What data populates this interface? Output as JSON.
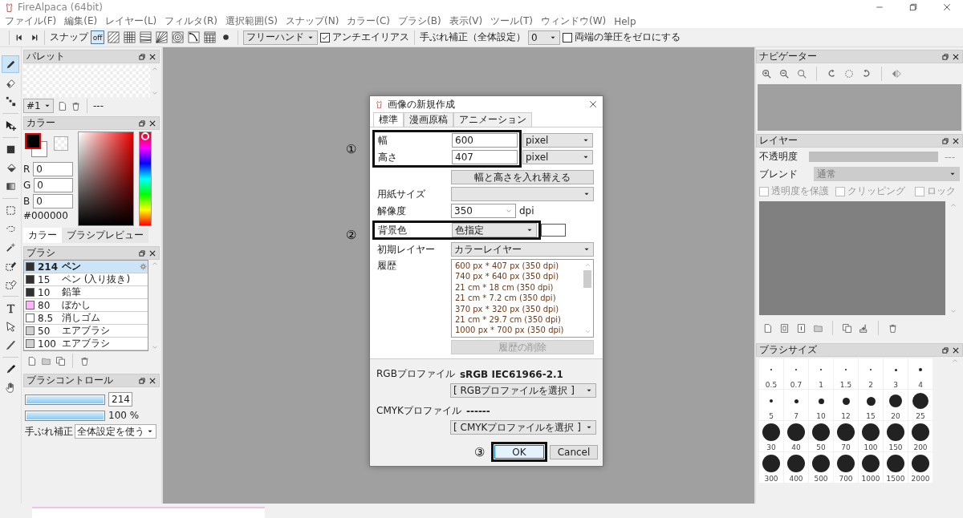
{
  "window": {
    "title": "FireAlpaca (64bit)"
  },
  "menu": [
    "ファイル(F)",
    "編集(E)",
    "レイヤー(L)",
    "フィルタ(R)",
    "選択範囲(S)",
    "スナップ(N)",
    "カラー(C)",
    "ブラシ(B)",
    "表示(V)",
    "ツール(T)",
    "ウィンドウ(W)",
    "Help"
  ],
  "toolbar": {
    "snap_label": "スナップ",
    "snap_modes": [
      {
        "kind": "off",
        "label": "off",
        "selected": true
      },
      {
        "kind": "parallel",
        "selected": false
      },
      {
        "kind": "grid",
        "selected": false
      },
      {
        "kind": "cross",
        "selected": false
      },
      {
        "kind": "radial",
        "selected": false
      },
      {
        "kind": "concentric",
        "selected": false
      },
      {
        "kind": "curve",
        "selected": false
      },
      {
        "kind": "perspective",
        "selected": false
      },
      {
        "kind": "point",
        "selected": false
      }
    ],
    "stroke_mode": "フリーハンド",
    "antialias": {
      "label": "アンチエイリアス",
      "checked": true
    },
    "stabilizer_label": "手ぶれ補正（全体設定）",
    "stabilizer_value": "0",
    "zero_pressure": {
      "label": "両端の筆圧をゼロにする",
      "checked": false
    }
  },
  "tool_groups": [
    [
      {
        "kind": "pen",
        "selected": true
      },
      {
        "kind": "eraser",
        "selected": false
      },
      {
        "kind": "dot",
        "selected": false
      }
    ],
    [
      {
        "kind": "move",
        "selected": false
      }
    ],
    [
      {
        "kind": "fill",
        "selected": false
      },
      {
        "kind": "bucket",
        "selected": false
      },
      {
        "kind": "gradient",
        "selected": false
      }
    ],
    [
      {
        "kind": "select",
        "selected": false
      },
      {
        "kind": "lasso",
        "selected": false
      },
      {
        "kind": "wand",
        "selected": false
      },
      {
        "kind": "select-pen",
        "selected": false
      },
      {
        "kind": "select-eraser",
        "selected": false
      }
    ],
    [
      {
        "kind": "text",
        "selected": false
      },
      {
        "kind": "pointer",
        "selected": false
      },
      {
        "kind": "blur",
        "selected": false
      }
    ],
    [
      {
        "kind": "eyedropper",
        "selected": false
      },
      {
        "kind": "hand",
        "selected": false
      }
    ]
  ],
  "palette": {
    "title": "パレット",
    "selector": "#1",
    "info": "---"
  },
  "color": {
    "title": "カラー",
    "fields": [
      {
        "label": "R",
        "value": "0"
      },
      {
        "label": "G",
        "value": "0"
      },
      {
        "label": "B",
        "value": "0"
      }
    ],
    "hex": "#000000",
    "hue": {
      "level": 1
    },
    "tabs": [
      {
        "label": "カラー",
        "selected": true
      },
      {
        "label": "ブラシプレビュー",
        "selected": false
      }
    ]
  },
  "brushes": {
    "title": "ブラシ",
    "items": [
      {
        "size": "214",
        "name": "ペン",
        "color": "#303030",
        "selected": true
      },
      {
        "size": "15",
        "name": "ペン (入り抜き)",
        "color": "#303030",
        "selected": false
      },
      {
        "size": "10",
        "name": "鉛筆",
        "color": "#303030",
        "selected": false
      },
      {
        "size": "80",
        "name": "ぼかし",
        "color": "#ffb3ff",
        "selected": false
      },
      {
        "size": "8.5",
        "name": "消しゴム",
        "color": "#ffffff",
        "selected": false
      },
      {
        "size": "50",
        "name": "エアブラシ",
        "color": "#d0d0d0",
        "selected": false
      },
      {
        "size": "100",
        "name": "エアブラシ",
        "color": "#d0d0d0",
        "selected": false
      }
    ]
  },
  "brush_control": {
    "title": "ブラシコントロール",
    "size": {
      "level": 1,
      "reading": "214"
    },
    "opacity": {
      "level": 1,
      "reading": "100 %"
    },
    "stabilizer_label": "手ぶれ補正",
    "stabilizer_value": "全体設定を使う"
  },
  "dialog": {
    "title": "画像の新規作成",
    "tabs": [
      {
        "label": "標準",
        "selected": true
      },
      {
        "label": "漫画原稿",
        "selected": false
      },
      {
        "label": "アニメーション",
        "selected": false
      }
    ],
    "size_annotation": "①",
    "width": {
      "label": "幅",
      "value": "600",
      "unit": "pixel"
    },
    "height": {
      "label": "高さ",
      "value": "407",
      "unit": "pixel"
    },
    "swap_button": "幅と高さを入れ替える",
    "paper_size": {
      "label": "用紙サイズ"
    },
    "resolution": {
      "label": "解像度",
      "value": "350",
      "unit": "dpi"
    },
    "background_annotation": "②",
    "background": {
      "label": "背景色",
      "value": "色指定"
    },
    "initial_layer": {
      "label": "初期レイヤー",
      "value": "カラーレイヤー"
    },
    "history": {
      "label": "履歴",
      "items": [
        "600 px * 407 px (350 dpi)",
        "740 px * 640 px (350 dpi)",
        "21 cm * 18 cm (350 dpi)",
        "21 cm * 7.2 cm (350 dpi)",
        "370 px * 320 px (350 dpi)",
        "21 cm * 29.7 cm (350 dpi)",
        "1000 px * 700 px (350 dpi)"
      ]
    },
    "delete_history": {
      "label": "履歴の削除",
      "disabled": true
    },
    "rgb_profile": {
      "label": "RGBプロファイル",
      "current": "sRGB IEC61966-2.1",
      "select": "[ RGBプロファイルを選択 ]"
    },
    "cmyk_profile": {
      "label": "CMYKプロファイル",
      "current": "------",
      "select": "[ CMYKプロファイルを選択 ]"
    },
    "ok_annotation": "③",
    "ok": "OK",
    "cancel": "Cancel"
  },
  "navigator": {
    "title": "ナビゲーター"
  },
  "layers": {
    "title": "レイヤー",
    "disabled": true,
    "opacity_label": "不透明度",
    "opacity_reading": "---",
    "blend_label": "ブレンド",
    "blend_value": "通常",
    "options": [
      {
        "label": "透明度を保護",
        "checked": false
      },
      {
        "label": "クリッピング",
        "checked": false
      },
      {
        "label": "ロック",
        "checked": false
      }
    ]
  },
  "brush_size": {
    "title": "ブラシサイズ",
    "sizes": [
      "0.5",
      "0.7",
      "1",
      "1.5",
      "2",
      "3",
      "4",
      "5",
      "7",
      "10",
      "12",
      "15",
      "20",
      "25",
      "30",
      "40",
      "50",
      "70",
      "100",
      "150",
      "200",
      "300",
      "400",
      "500",
      "700",
      "1000",
      "1500",
      "2000"
    ]
  }
}
